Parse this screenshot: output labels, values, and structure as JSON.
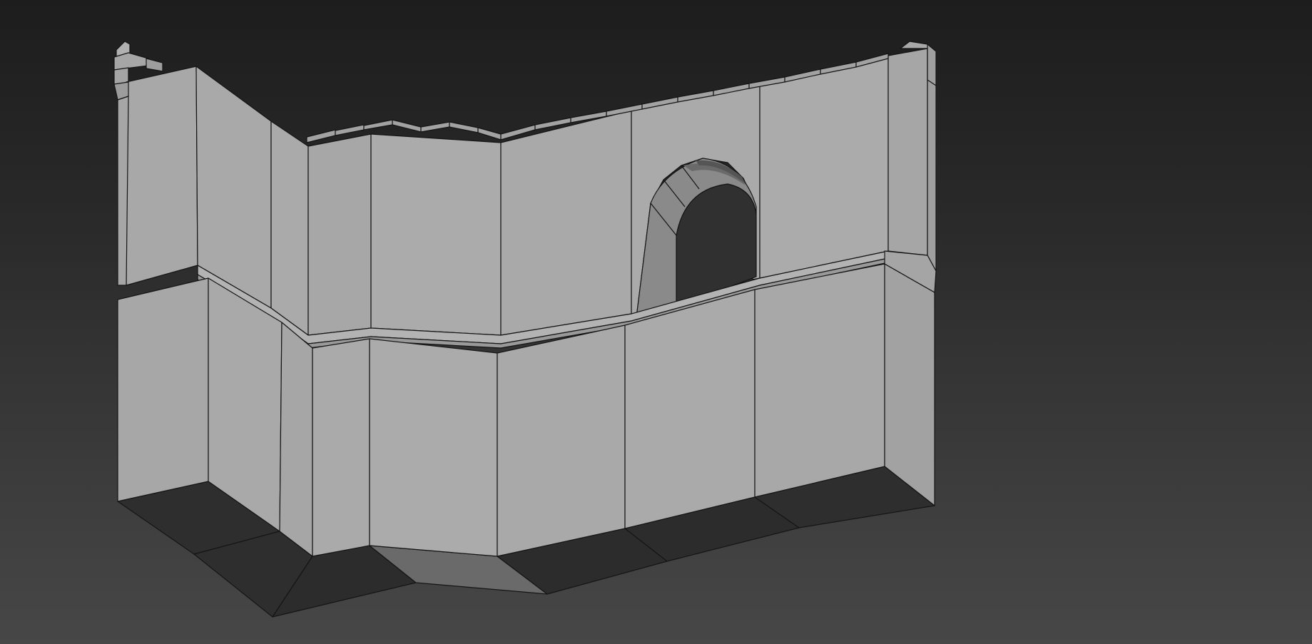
{
  "viewport": {
    "background_top": "#1d1d1d",
    "background_bottom": "#474747",
    "shading_mode": "edged-faces"
  },
  "model": {
    "object": "castle-wall-corner",
    "surface_color": "#a8a8a8",
    "surface_light": "#b4b4b4",
    "surface_dark": "#9a9a9a",
    "base_shadow_color": "#2e2e2e",
    "wire_color": "#151515",
    "features": [
      "crenellations",
      "arched-window",
      "ledge",
      "base-plinth"
    ]
  }
}
